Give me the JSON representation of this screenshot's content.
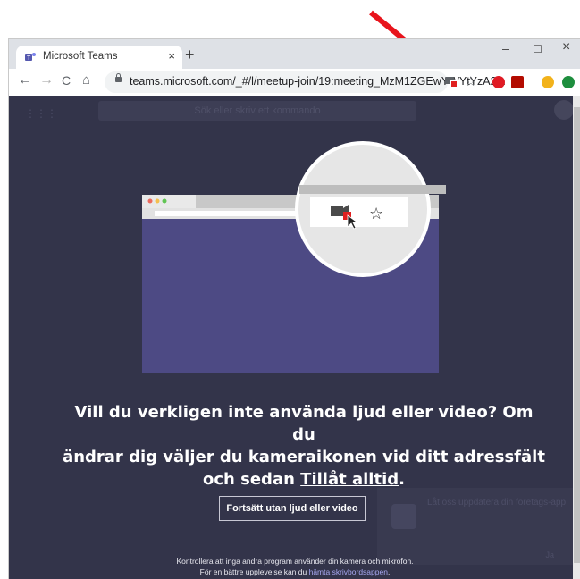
{
  "browser": {
    "tab_title": "Microsoft Teams",
    "tab_close": "×",
    "new_tab": "+",
    "minimize": "–",
    "maximize": "☐",
    "close": "×",
    "url": "teams.microsoft.com/_#/l/meetup-join/19:meeting_MzM1ZGEwYWYtYzA2...",
    "back": "←",
    "forward": "→",
    "reload": "C",
    "home": "⌂",
    "bookmark": "☆"
  },
  "page": {
    "dimmed_search": "Sök eller skriv ett kommando",
    "main_text_line1": "Vill du verkligen inte använda ljud eller video? Om du",
    "main_text_line2": "ändrar dig väljer du kameraikonen vid ditt adressfält",
    "main_text_line3_pre": "och sedan ",
    "main_text_link": "Tillåt alltid",
    "main_text_line3_post": ".",
    "continue_button": "Fortsätt utan ljud eller video",
    "footer_line1": "Kontrollera att inga andra program använder din kamera och mikrofon.",
    "footer_line2_pre": "För en bättre upplevelse kan du ",
    "footer_link": "hämta skrivbordsappen",
    "footer_line2_post": ".",
    "dimmed_toast_text": "Låt oss uppdatera din företags-app",
    "dimmed_toast_button": "Ja"
  },
  "colors": {
    "arrow": "#e8141c",
    "teams_bg": "#33344a",
    "illus_purple": "#4d4a84",
    "link": "#a6a7f0"
  }
}
